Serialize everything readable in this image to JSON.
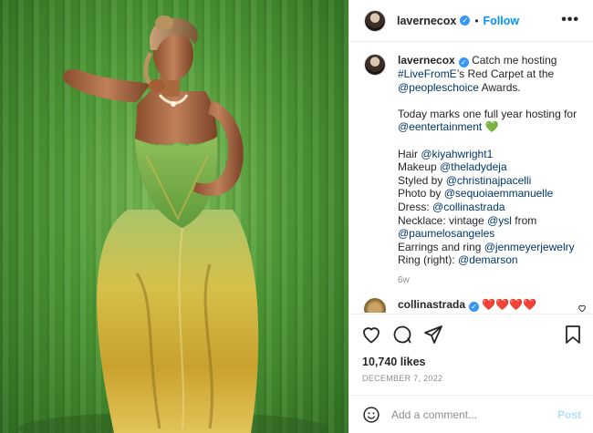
{
  "post": {
    "username": "lavernecox",
    "follow_label": "Follow",
    "more_label": "•••",
    "caption": {
      "username": "lavernecox",
      "intro": "Catch me hosting",
      "tag_livefrom": "#LiveFromE",
      "after_livefrom": "’s Red Carpet at the",
      "tag_pca": "@peopleschoice",
      "after_pca": " Awards.",
      "line2": "Today marks one full year hosting for",
      "tag_eent": "@eentertainment",
      "green_heart": "💚",
      "hair_label": "Hair",
      "hair_tag": "@kiyahwright1",
      "makeup_label": "Makeup",
      "makeup_tag": "@theladydeja",
      "styled_label": "Styled by",
      "styled_tag": "@christinajpacelli",
      "photo_label": "Photo by",
      "photo_tag": "@sequoiaemmanuelle",
      "dress_label": "Dress:",
      "dress_tag": "@collinastrada",
      "necklace_label": "Necklace: vintage",
      "necklace_tag": "@ysl",
      "necklace_from": "from",
      "necklace_tag2": "@paumelosangeles",
      "earrings_label": "Earrings and ring",
      "earrings_tag": "@jenmeyerjewelry",
      "ring_label": "Ring (right):",
      "ring_tag": "@demarson",
      "time": "6w"
    },
    "comment": {
      "username": "collinastrada",
      "hearts": "❤️❤️❤️❤️"
    },
    "likes": "10,740 likes",
    "date": "DECEMBER 7, 2022",
    "add_comment_placeholder": "Add a comment...",
    "post_button": "Post"
  },
  "icons": {
    "like": "heart-icon",
    "comment": "comment-icon",
    "share": "share-icon",
    "save": "bookmark-icon",
    "emoji": "emoji-icon"
  },
  "colors": {
    "link": "#00376b",
    "follow": "#0095f6",
    "verified": "#3897f0",
    "post_disabled": "#b2dffc"
  }
}
